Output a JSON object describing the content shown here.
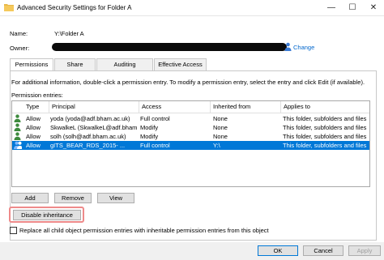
{
  "window": {
    "title": "Advanced Security Settings for Folder A",
    "icon": "folder-icon",
    "minimize_glyph": "—",
    "maximize_glyph": "☐",
    "close_glyph": "✕"
  },
  "fields": {
    "name_label": "Name:",
    "name_value": "Y:\\Folder A",
    "owner_label": "Owner:",
    "change_link": "Change"
  },
  "tabs": [
    {
      "label": "Permissions",
      "active": true
    },
    {
      "label": "Share",
      "active": false
    },
    {
      "label": "Auditing",
      "active": false
    },
    {
      "label": "Effective Access",
      "active": false
    }
  ],
  "panel": {
    "info": "For additional information, double-click a permission entry. To modify a permission entry, select the entry and click Edit (if available).",
    "entries_label": "Permission entries:"
  },
  "grid": {
    "headers": [
      "Type",
      "Principal",
      "Access",
      "Inherited from",
      "Applies to"
    ],
    "rows": [
      {
        "icon": "user-icon",
        "type": "Allow",
        "principal": "yoda (yoda@adf.bham.ac.uk)",
        "access": "Full control",
        "inherited": "None",
        "applies": "This folder, subfolders and files",
        "selected": false
      },
      {
        "icon": "user-icon",
        "type": "Allow",
        "principal": "SkwalkeL (SkwalkeL@adf.bham.ac.uk)",
        "access": "Modify",
        "inherited": "None",
        "applies": "This folder, subfolders and files",
        "selected": false
      },
      {
        "icon": "user-icon",
        "type": "Allow",
        "principal": "solh (solh@adf.bham.ac.uk)",
        "access": "Modify",
        "inherited": "None",
        "applies": "This folder, subfolders and files",
        "selected": false
      },
      {
        "icon": "group-icon",
        "type": "Allow",
        "principal": "gITS_BEAR_RDS_2015- ...",
        "access": "Full control",
        "inherited": "Y:\\",
        "applies": "This folder, subfolders and files",
        "selected": true
      }
    ]
  },
  "buttons": {
    "add": "Add",
    "remove": "Remove",
    "view": "View",
    "disable_inheritance": "Disable inheritance",
    "ok": "OK",
    "cancel": "Cancel",
    "apply": "Apply"
  },
  "replace": {
    "checked": false,
    "label": "Replace all child object permission entries with inheritable permission entries from this object"
  },
  "colors": {
    "selection": "#0078d7",
    "link": "#0066cc",
    "highlight": "#ee8a8a"
  }
}
